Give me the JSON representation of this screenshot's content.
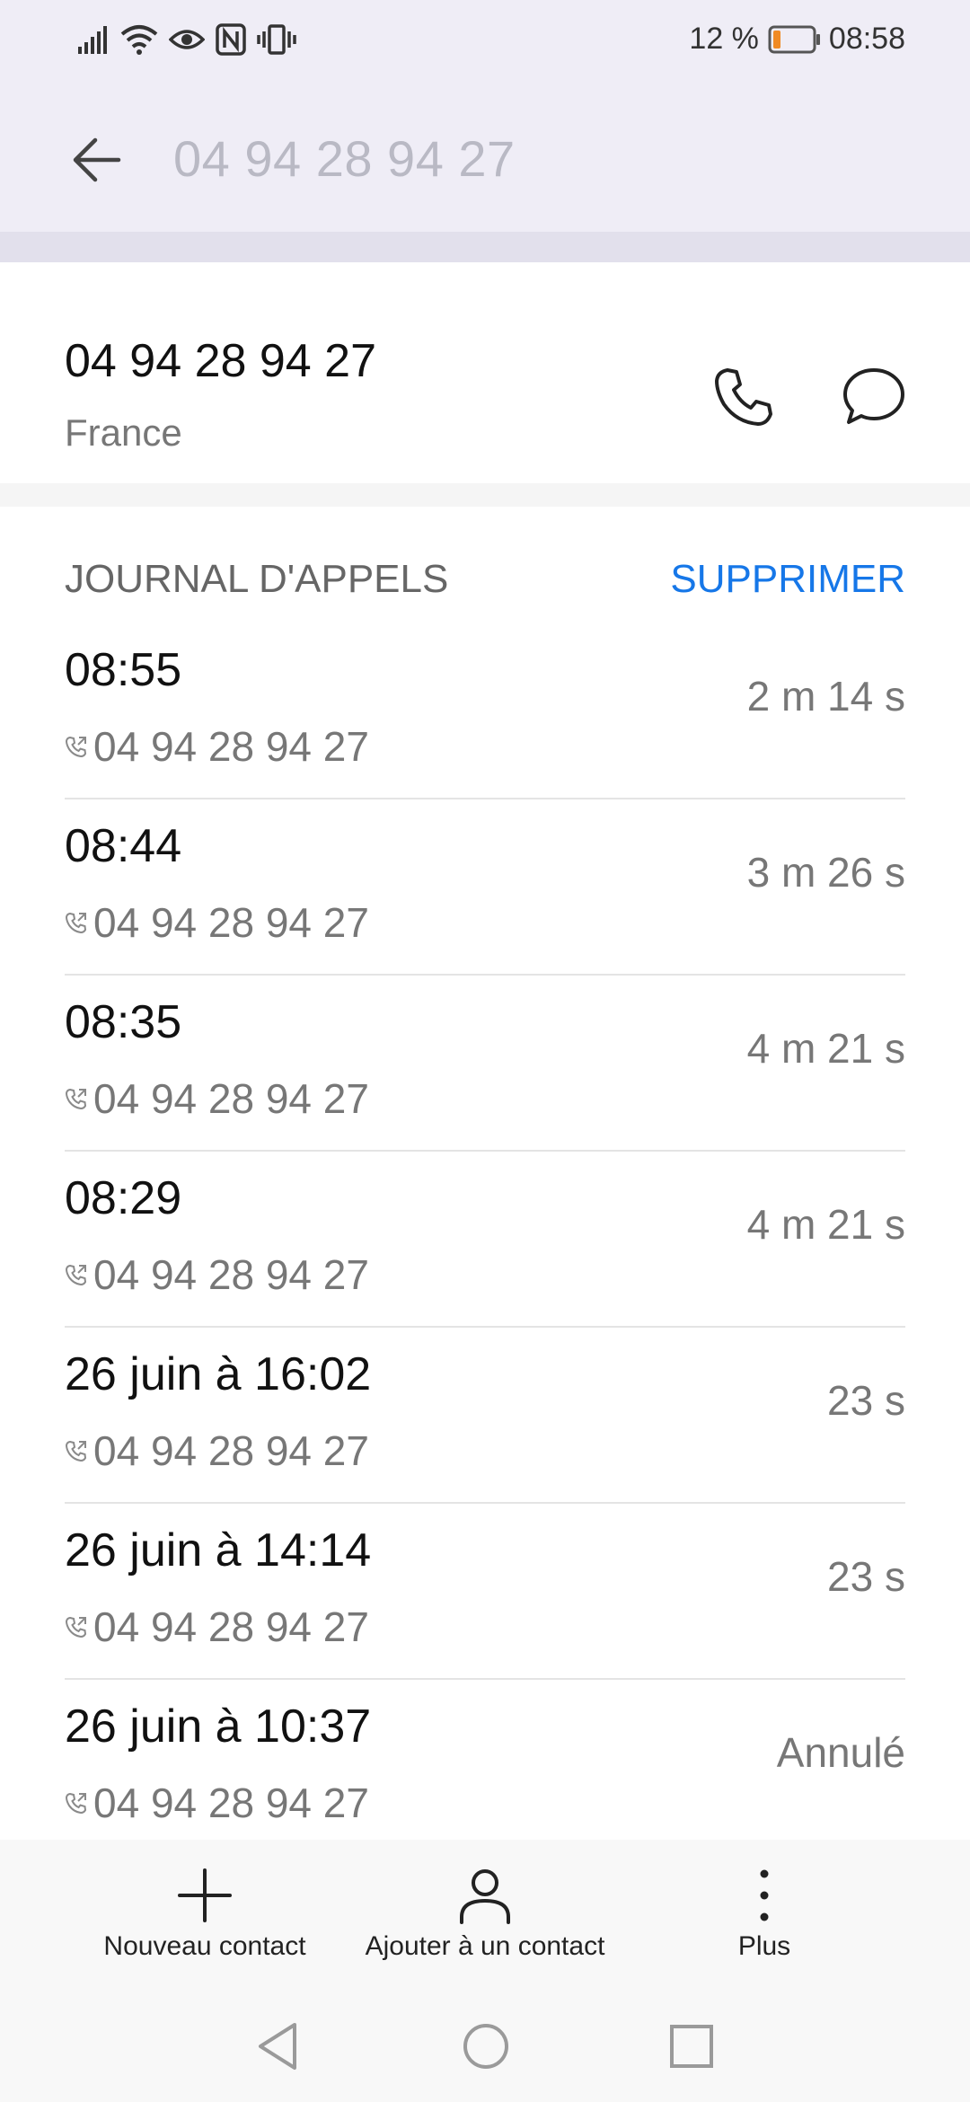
{
  "status_bar": {
    "battery_text": "12 %",
    "time": "08:58",
    "battery_level": 0.12,
    "icons": [
      "signal-icon",
      "wifi-icon",
      "eye-icon",
      "nfc-icon",
      "vibrate-icon",
      "battery-icon"
    ]
  },
  "app_bar": {
    "title": "04 94 28 94 27",
    "back_icon": "arrow-left-icon"
  },
  "contact": {
    "number": "04 94 28 94 27",
    "country": "France",
    "call_icon": "phone-icon",
    "message_icon": "chat-bubble-icon"
  },
  "call_log": {
    "header": "JOURNAL D'APPELS",
    "delete_label": "SUPPRIMER",
    "entries": [
      {
        "date": "08:55",
        "number": "04 94 28 94 27",
        "duration": "2 m 14 s"
      },
      {
        "date": "08:44",
        "number": "04 94 28 94 27",
        "duration": "3 m 26 s"
      },
      {
        "date": "08:35",
        "number": "04 94 28 94 27",
        "duration": "4 m 21 s"
      },
      {
        "date": "08:29",
        "number": "04 94 28 94 27",
        "duration": "4 m 21 s"
      },
      {
        "date": "26 juin à 16:02",
        "number": "04 94 28 94 27",
        "duration": "23 s"
      },
      {
        "date": "26 juin à 14:14",
        "number": "04 94 28 94 27",
        "duration": "23 s"
      },
      {
        "date": "26 juin à 10:37",
        "number": "04 94 28 94 27",
        "duration": "Annulé"
      }
    ]
  },
  "bottom_bar": {
    "new_contact": "Nouveau contact",
    "add_to_contact": "Ajouter à un contact",
    "more": "Plus"
  },
  "colors": {
    "accent": "#1677e8",
    "header_bg": "#efedf6",
    "battery_low": "#f08a24"
  }
}
